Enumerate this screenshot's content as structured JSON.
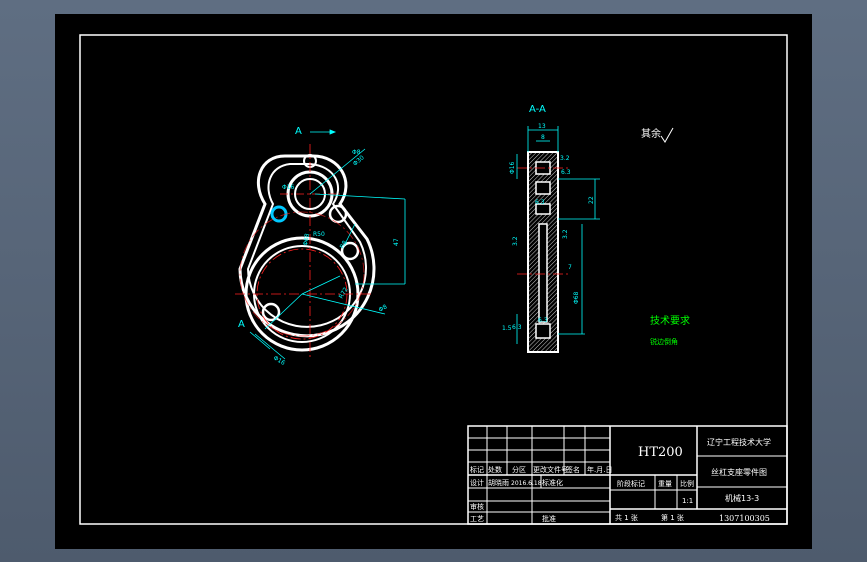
{
  "colors": {
    "part": "#ffffff",
    "dimension": "#00ffff",
    "centerline": "#ff2020",
    "frame": "#ffffff",
    "note": "#00ff00",
    "hole_accent": "#00c8ff"
  },
  "views": {
    "front": {
      "section_label_top": "A",
      "section_label_bottom": "A",
      "dims": [
        "Φ8",
        "Φ30",
        "Φ16",
        "R50",
        "47",
        "Φ68",
        "R8",
        "R72",
        "Φ8",
        "Φ16"
      ]
    },
    "section": {
      "title": "A-A",
      "dims": [
        "13",
        "8",
        "Φ16",
        "3.2",
        "6.3",
        "22",
        "6.3",
        "3.2",
        "3.2",
        "7",
        "Φ68",
        "6.3",
        "6.3",
        "1.5"
      ]
    }
  },
  "surface_note": "其余",
  "tech": {
    "heading": "技术要求",
    "line1": "锐边倒角"
  },
  "title_block": {
    "material": "HT200",
    "school": "辽宁工程技术大学",
    "part_name": "丝杠支座零件图",
    "drawing_no": "机械13-3",
    "student_id": "1307100305",
    "header_row": [
      "标记",
      "处数",
      "分区",
      "更改文件号",
      "签名",
      "年.月.日"
    ],
    "design_row": [
      "设计",
      "胡晓雨",
      "2016.6.18",
      "标准化"
    ],
    "check_label": "审核",
    "process_label": "工艺",
    "approve_label": "批准",
    "stage_label": "阶段标记",
    "weight_label": "重量",
    "scale_label": "比例",
    "scale_value": "1:1",
    "sheet_total": "共 1 张",
    "sheet_no": "第 1 张"
  }
}
